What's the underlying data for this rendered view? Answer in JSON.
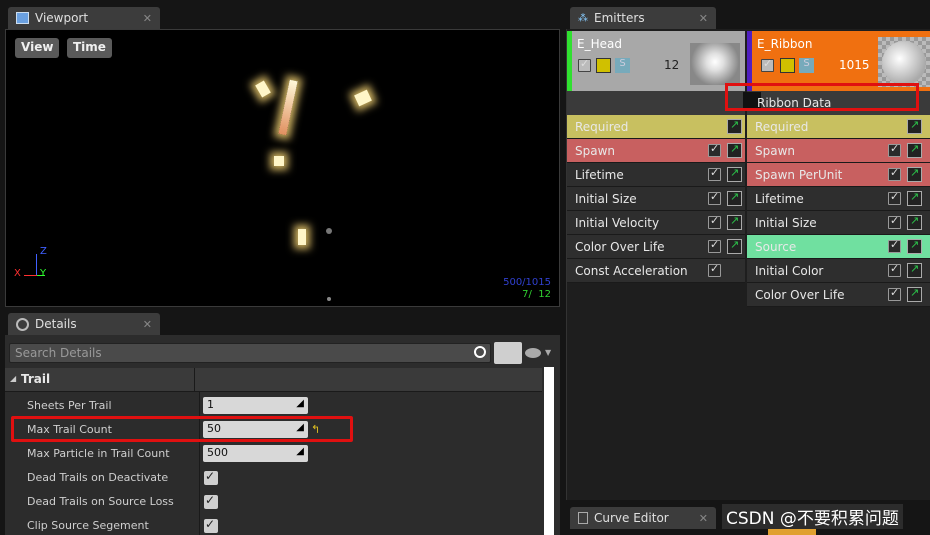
{
  "viewport": {
    "tab_title": "Viewport",
    "close": "✕",
    "view_btn": "View",
    "time_btn": "Time",
    "stats_top": "500/1015",
    "stats_bottom": "7/  12",
    "axis_x": "X",
    "axis_y": "Y",
    "axis_z": "Z"
  },
  "details": {
    "tab_title": "Details",
    "close": "✕",
    "search_placeholder": "Search Details",
    "section": "Trail",
    "rows": [
      {
        "label": "Sheets Per Trail",
        "value": "1"
      },
      {
        "label": "Max Trail Count",
        "value": "50"
      },
      {
        "label": "Max Particle in Trail Count",
        "value": "500"
      },
      {
        "label": "Dead Trails on Deactivate",
        "checked": true
      },
      {
        "label": "Dead Trails on Source Loss",
        "checked": true
      },
      {
        "label": "Clip Source Segement",
        "checked": true
      }
    ]
  },
  "emitters": {
    "tab_title": "Emitters",
    "close": "✕",
    "head": {
      "name": "E_Head",
      "count": "12",
      "s_badge": "S",
      "modules": [
        "Required",
        "Spawn",
        "Lifetime",
        "Initial Size",
        "Initial Velocity",
        "Color Over Life",
        "Const Acceleration"
      ]
    },
    "ribbon": {
      "name": "E_Ribbon",
      "count": "1015",
      "s_badge": "S",
      "type_data": "Ribbon Data",
      "modules": [
        "Required",
        "Spawn",
        "Spawn PerUnit",
        "Lifetime",
        "Initial Size",
        "Source",
        "Initial Color",
        "Color Over Life"
      ]
    }
  },
  "curve_editor": {
    "tab_title": "Curve Editor",
    "close": "✕"
  },
  "watermark": "CSDN @不要积累问题",
  "colors": {
    "required": "#c8c060",
    "spawn": "#c86060",
    "source": "#70e0a0",
    "ribbon_header": "#f07010",
    "highlight": "#e01010"
  }
}
